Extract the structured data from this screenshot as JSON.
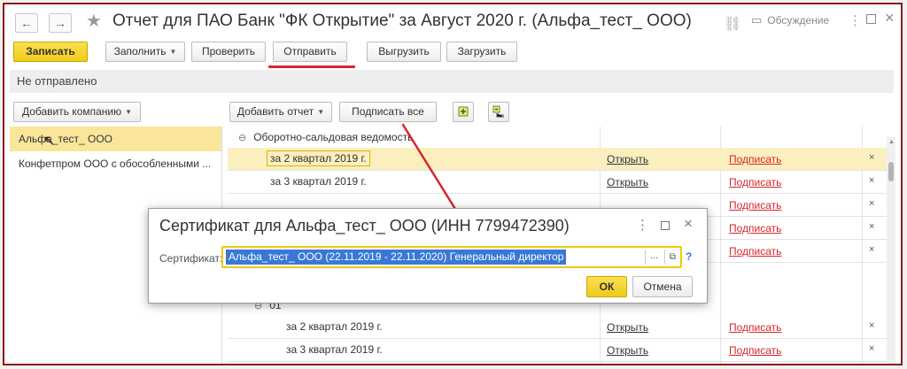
{
  "window": {
    "title": "Отчет для ПАО Банк \"ФК Открытие\" за Август 2020 г. (Альфа_тест_ ООО)",
    "discussion_label": "Обсуждение",
    "back_glyph": "←",
    "forward_glyph": "→",
    "star_glyph": "★",
    "more_glyph": "⋮",
    "close_glyph": "×",
    "link_glyph": "⛓",
    "discussion_glyph": "▭"
  },
  "toolbar": {
    "save": "Записать",
    "fill": "Заполнить",
    "check": "Проверить",
    "send": "Отправить",
    "upload": "Выгрузить",
    "download": "Загрузить"
  },
  "status": "Не отправлено",
  "left": {
    "add_company": "Добавить компанию",
    "companies": [
      "Альфа_тест_ ООО",
      "Конфетпром ООО с обособленными ..."
    ]
  },
  "right": {
    "add_report": "Добавить отчет",
    "sign_all": "Подписать все",
    "group1": "Оборотно-сальдовая ведомость",
    "group2": "01",
    "collapse_glyph": "⊖",
    "open_label": "Открыть",
    "sign_label": "Подписать",
    "delete_glyph": "×",
    "rows_top": [
      "за 2 квартал 2019 г.",
      "за 3 квартал 2019 г."
    ],
    "rows_bottom": [
      "за 2 квартал 2019 г.",
      "за 3 квартал 2019 г."
    ]
  },
  "dialog": {
    "title": "Сертификат для Альфа_тест_ ООО (ИНН 7799472390)",
    "cert_label": "Сертификат:",
    "cert_value": "Альфа_тест_ ООО (22.11.2019 - 22.11.2020) Генеральный директор",
    "ellipsis": "...",
    "help": "?",
    "ok": "ОК",
    "cancel": "Отмена"
  },
  "colors": {
    "accent_yellow": "#f1cb1a",
    "highlight_row": "#fbefc0",
    "selection_blue": "#3a78d6",
    "annotation_red": "#d7262c",
    "frame_border": "#8b1a1a"
  }
}
